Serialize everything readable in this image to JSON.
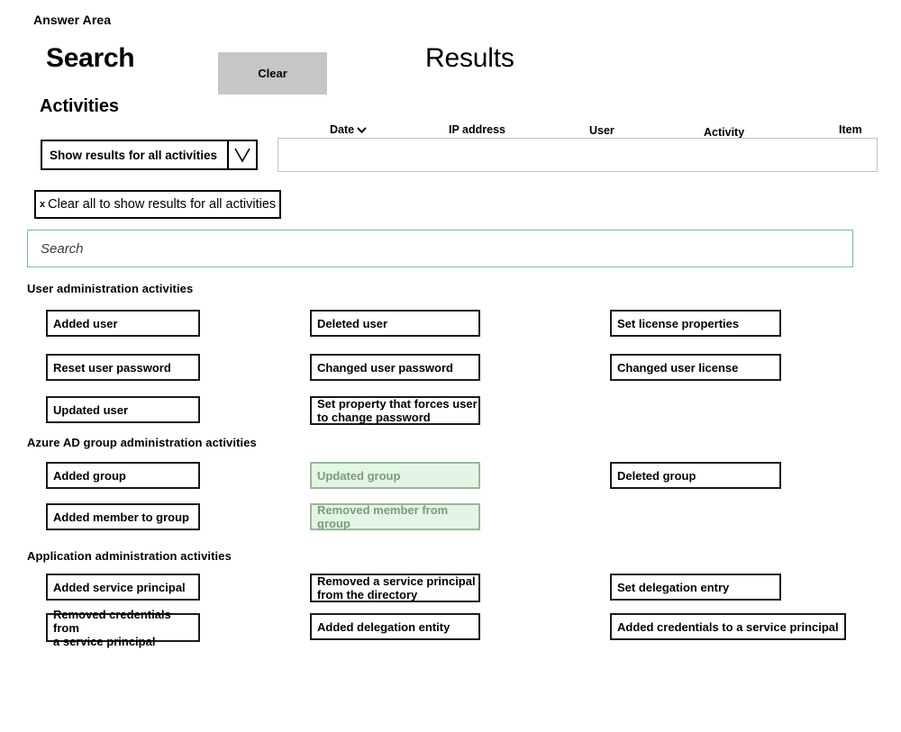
{
  "page": {
    "answer_area_label": "Answer Area"
  },
  "headings": {
    "search": "Search",
    "results": "Results",
    "activities": "Activities"
  },
  "toolbar": {
    "clear_label": "Clear"
  },
  "filters": {
    "dropdown_value": "Show results for all activities",
    "dropdown_icon": "chevron-down-icon",
    "chip_remove_icon": "x",
    "chip_label": "Clear all to show results for all activities"
  },
  "search": {
    "value": "",
    "placeholder": "Search"
  },
  "results_table": {
    "columns": [
      {
        "label": "Date",
        "sort_icon": "caret-down-icon"
      },
      {
        "label": "IP address"
      },
      {
        "label": "User"
      },
      {
        "label": "Activity"
      },
      {
        "label": "Item"
      }
    ],
    "rows": []
  },
  "sections": [
    {
      "id": "user-administration",
      "label": "User administration activities",
      "tiles": [
        {
          "label": "Added user",
          "column": 0,
          "row": 0,
          "selected": false
        },
        {
          "label": "Reset user password",
          "column": 0,
          "row": 1,
          "selected": false
        },
        {
          "label": "Updated user",
          "column": 0,
          "row": 2,
          "selected": false
        },
        {
          "label": "Deleted user",
          "column": 1,
          "row": 0,
          "selected": false
        },
        {
          "label": "Changed user password",
          "column": 1,
          "row": 1,
          "selected": false
        },
        {
          "label": "Set property that forces user\nto change password",
          "column": 1,
          "row": 2,
          "selected": false
        },
        {
          "label": "Set license properties",
          "column": 2,
          "row": 0,
          "selected": false
        },
        {
          "label": "Changed user license",
          "column": 2,
          "row": 1,
          "selected": false
        }
      ]
    },
    {
      "id": "azure-ad-group-administration",
      "label": "Azure AD group administration activities",
      "tiles": [
        {
          "label": "Added group",
          "column": 0,
          "row": 0,
          "selected": false
        },
        {
          "label": "Added member to group",
          "column": 0,
          "row": 1,
          "selected": false
        },
        {
          "label": "Updated group",
          "column": 1,
          "row": 0,
          "selected": true
        },
        {
          "label": "Removed member from group",
          "column": 1,
          "row": 1,
          "selected": true
        },
        {
          "label": "Deleted group",
          "column": 2,
          "row": 0,
          "selected": false
        }
      ]
    },
    {
      "id": "application-administration",
      "label": "Application administration activities",
      "tiles": [
        {
          "label": "Added service principal",
          "column": 0,
          "row": 0,
          "selected": false
        },
        {
          "label": "Removed credentials from\na service principal",
          "column": 0,
          "row": 1,
          "selected": false
        },
        {
          "label": "Removed a service principal\nfrom the directory",
          "column": 1,
          "row": 0,
          "selected": false
        },
        {
          "label": "Added delegation entity",
          "column": 1,
          "row": 1,
          "selected": false
        },
        {
          "label": "Set delegation entry",
          "column": 2,
          "row": 0,
          "selected": false
        },
        {
          "label": "Added credentials to a service principal",
          "column": 2,
          "row": 1,
          "selected": false
        }
      ]
    }
  ],
  "colors": {
    "selected_background": "#e3f6e4",
    "selected_text": "#7e9a80",
    "selected_border": "#9ab79b",
    "clear_button_background": "#c6c6c6",
    "search_border": "#7fb6bd",
    "results_panel_border": "#c3c3c3",
    "tile_border": "#1a1a1a"
  }
}
